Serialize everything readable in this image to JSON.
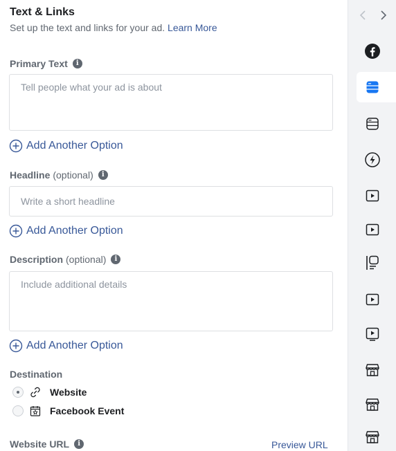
{
  "section": {
    "title": "Text & Links",
    "subtitle": "Set up the text and links for your ad.",
    "learn_more": "Learn More"
  },
  "primary_text": {
    "label": "Primary Text",
    "placeholder": "Tell people what your ad is about"
  },
  "headline": {
    "label": "Headline",
    "optional": "(optional)",
    "placeholder": "Write a short headline"
  },
  "description": {
    "label": "Description",
    "optional": "(optional)",
    "placeholder": "Include additional details"
  },
  "add_option_label": "Add Another Option",
  "destination": {
    "label": "Destination",
    "options": [
      {
        "label": "Website",
        "selected": true,
        "icon": "link-icon"
      },
      {
        "label": "Facebook Event",
        "selected": false,
        "icon": "calendar-star-icon"
      }
    ]
  },
  "website_url": {
    "label": "Website URL",
    "preview": "Preview URL"
  },
  "placements_rail": {
    "items": [
      {
        "icon": "facebook-icon"
      },
      {
        "icon": "feed-card-icon",
        "active": true
      },
      {
        "icon": "feed-card-icon"
      },
      {
        "icon": "lightning-icon"
      },
      {
        "icon": "video-play-icon"
      },
      {
        "icon": "video-play-icon"
      },
      {
        "icon": "in-stream-icon"
      },
      {
        "icon": "video-play-icon"
      },
      {
        "icon": "video-screen-icon"
      },
      {
        "icon": "marketplace-store-icon"
      },
      {
        "icon": "marketplace-store-icon"
      },
      {
        "icon": "marketplace-store-icon"
      }
    ]
  },
  "colors": {
    "link": "#385898",
    "active_icon": "#1877f2",
    "muted_text": "#606770"
  }
}
